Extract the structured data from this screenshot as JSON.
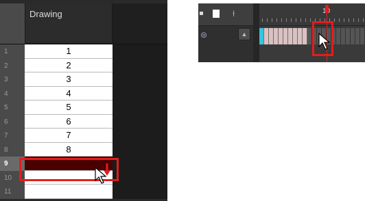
{
  "xsheet": {
    "column_header": "Drawing",
    "rows": [
      {
        "num": "1",
        "value": "1"
      },
      {
        "num": "2",
        "value": "2"
      },
      {
        "num": "3",
        "value": "3"
      },
      {
        "num": "4",
        "value": "4"
      },
      {
        "num": "5",
        "value": "5"
      },
      {
        "num": "6",
        "value": "6"
      },
      {
        "num": "7",
        "value": "7"
      },
      {
        "num": "8",
        "value": "8"
      },
      {
        "num": "9",
        "value": ""
      },
      {
        "num": "10",
        "value": ""
      },
      {
        "num": "11",
        "value": ""
      }
    ],
    "selected_row": "9",
    "accent_color": "#e51c1c",
    "selected_fill": "#4a0000"
  },
  "timeline": {
    "frame_label": "10",
    "current_frame": 9,
    "layer_icon": "layer-icon",
    "toolbar_icons": [
      "bullet-icon",
      "white-square-icon",
      "flip-horizontal-icon"
    ],
    "frame_color": "#d8c2c2",
    "first_frame_color": "#33c5e0",
    "playhead_color": "#e51c1c"
  }
}
